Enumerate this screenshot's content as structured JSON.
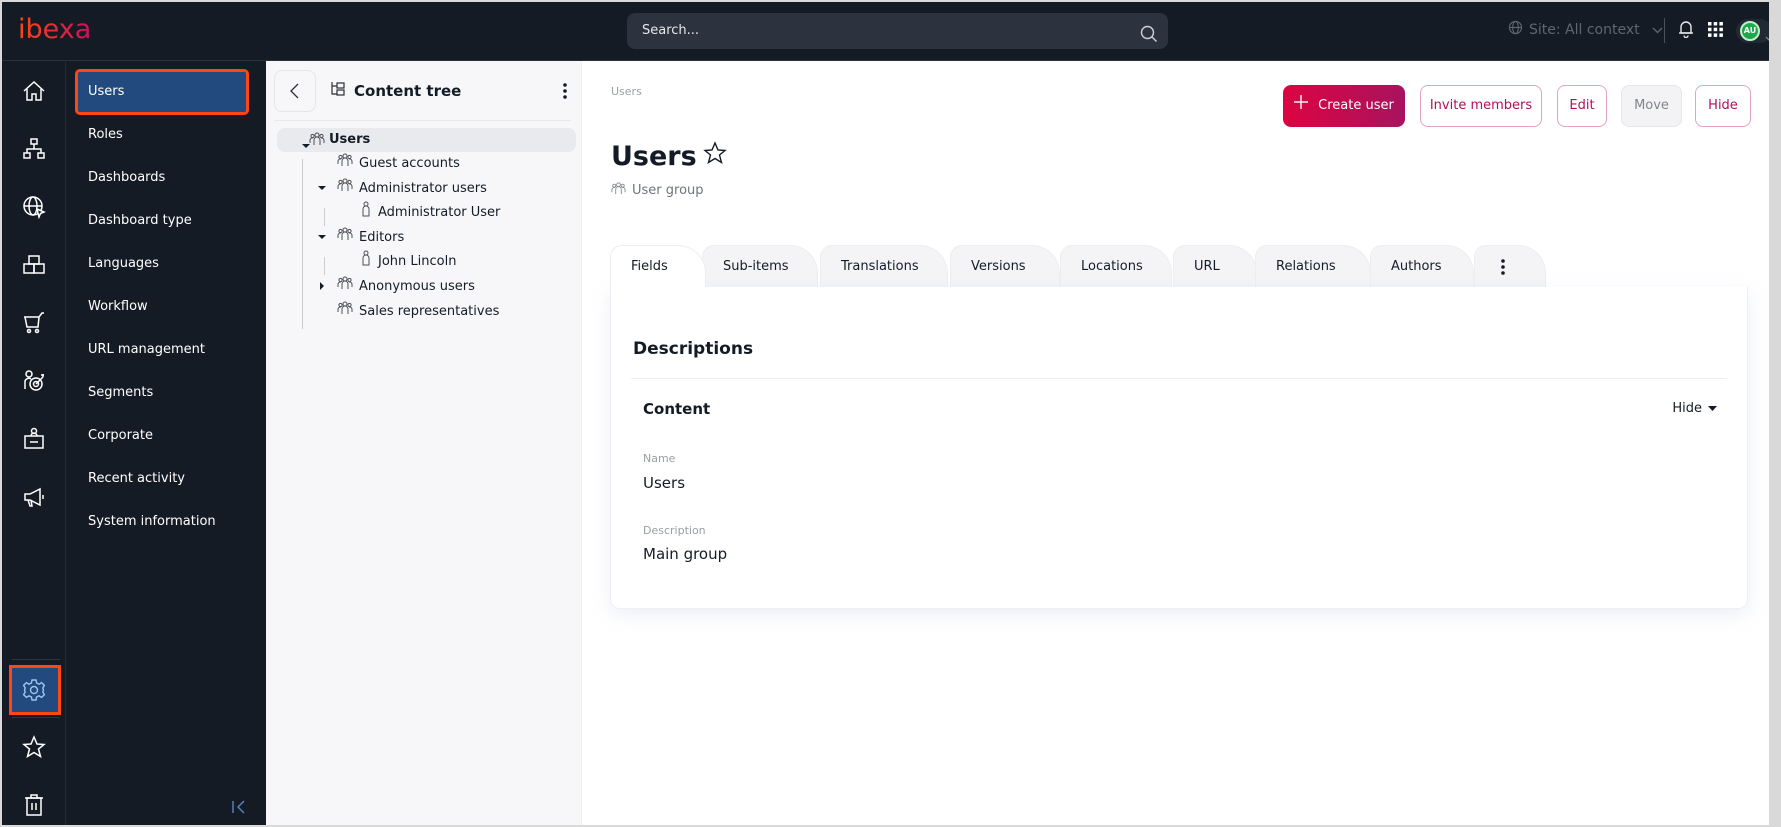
{
  "app": {
    "logo_text": "ibexa",
    "brand_color": "#ff4713"
  },
  "header": {
    "search_placeholder": "Search...",
    "site_selector": "Site: All context",
    "avatar_initials": "AU"
  },
  "rail": {
    "items": [
      {
        "icon": "home-icon"
      },
      {
        "icon": "sitemap-icon"
      },
      {
        "icon": "globe-cursor-icon"
      },
      {
        "icon": "boxes-icon"
      },
      {
        "icon": "cart-icon"
      },
      {
        "icon": "user-target-icon"
      },
      {
        "icon": "badge-icon"
      },
      {
        "icon": "megaphone-icon"
      },
      {
        "icon": "gear-icon",
        "active": true
      },
      {
        "icon": "star-icon"
      },
      {
        "icon": "trash-icon"
      }
    ]
  },
  "submenu": {
    "items": [
      {
        "label": "Users",
        "selected": true
      },
      {
        "label": "Roles"
      },
      {
        "label": "Dashboards"
      },
      {
        "label": "Dashboard type"
      },
      {
        "label": "Languages"
      },
      {
        "label": "Workflow"
      },
      {
        "label": "URL management"
      },
      {
        "label": "Segments"
      },
      {
        "label": "Corporate"
      },
      {
        "label": "Recent activity"
      },
      {
        "label": "System information"
      }
    ]
  },
  "tree": {
    "title": "Content tree",
    "nodes": [
      {
        "label": "Users",
        "type": "group",
        "level": 0,
        "expanded": true,
        "selected": true
      },
      {
        "label": "Guest accounts",
        "type": "group",
        "level": 1
      },
      {
        "label": "Administrator users",
        "type": "group",
        "level": 1,
        "expanded": true
      },
      {
        "label": "Administrator User",
        "type": "user",
        "level": 2
      },
      {
        "label": "Editors",
        "type": "group",
        "level": 1,
        "expanded": true
      },
      {
        "label": "John Lincoln",
        "type": "user",
        "level": 2
      },
      {
        "label": "Anonymous users",
        "type": "group",
        "level": 1,
        "expanded": false
      },
      {
        "label": "Sales representatives",
        "type": "group",
        "level": 1
      }
    ]
  },
  "main": {
    "breadcrumb": "Users",
    "title": "Users",
    "content_type": "User group",
    "actions": {
      "create": "Create user",
      "invite": "Invite members",
      "edit": "Edit",
      "move": "Move",
      "hide": "Hide"
    },
    "tabs": [
      "Fields",
      "Sub-items",
      "Translations",
      "Versions",
      "Locations",
      "URL",
      "Relations",
      "Authors"
    ],
    "active_tab": "Fields",
    "section_title": "Descriptions",
    "group_title": "Content",
    "group_toggle": "Hide",
    "fields": [
      {
        "label": "Name",
        "value": "Users"
      },
      {
        "label": "Description",
        "value": "Main group"
      }
    ]
  }
}
